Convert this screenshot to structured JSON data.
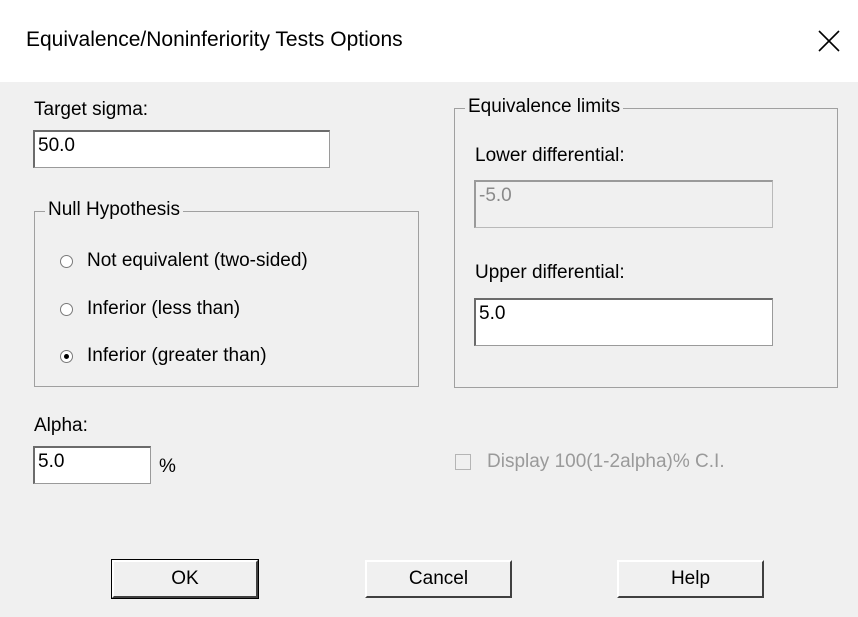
{
  "window": {
    "title": "Equivalence/Noninferiority Tests Options",
    "close_icon": "close-icon"
  },
  "target_sigma": {
    "label": "Target sigma:",
    "value": "50.0"
  },
  "null_hypothesis": {
    "legend": "Null Hypothesis",
    "options": [
      {
        "label": "Not equivalent (two-sided)",
        "selected": false
      },
      {
        "label": "Inferior (less than)",
        "selected": false
      },
      {
        "label": "Inferior (greater than)",
        "selected": true
      }
    ]
  },
  "equivalence_limits": {
    "legend": "Equivalence limits",
    "lower_label": "Lower differential:",
    "lower_value": "-5.0",
    "upper_label": "Upper differential:",
    "upper_value": "5.0"
  },
  "alpha": {
    "label": "Alpha:",
    "value": "5.0",
    "unit": "%"
  },
  "display_ci": {
    "label": "Display 100(1-2alpha)% C.I.",
    "checked": false,
    "enabled": false
  },
  "buttons": {
    "ok": "OK",
    "cancel": "Cancel",
    "help": "Help"
  }
}
